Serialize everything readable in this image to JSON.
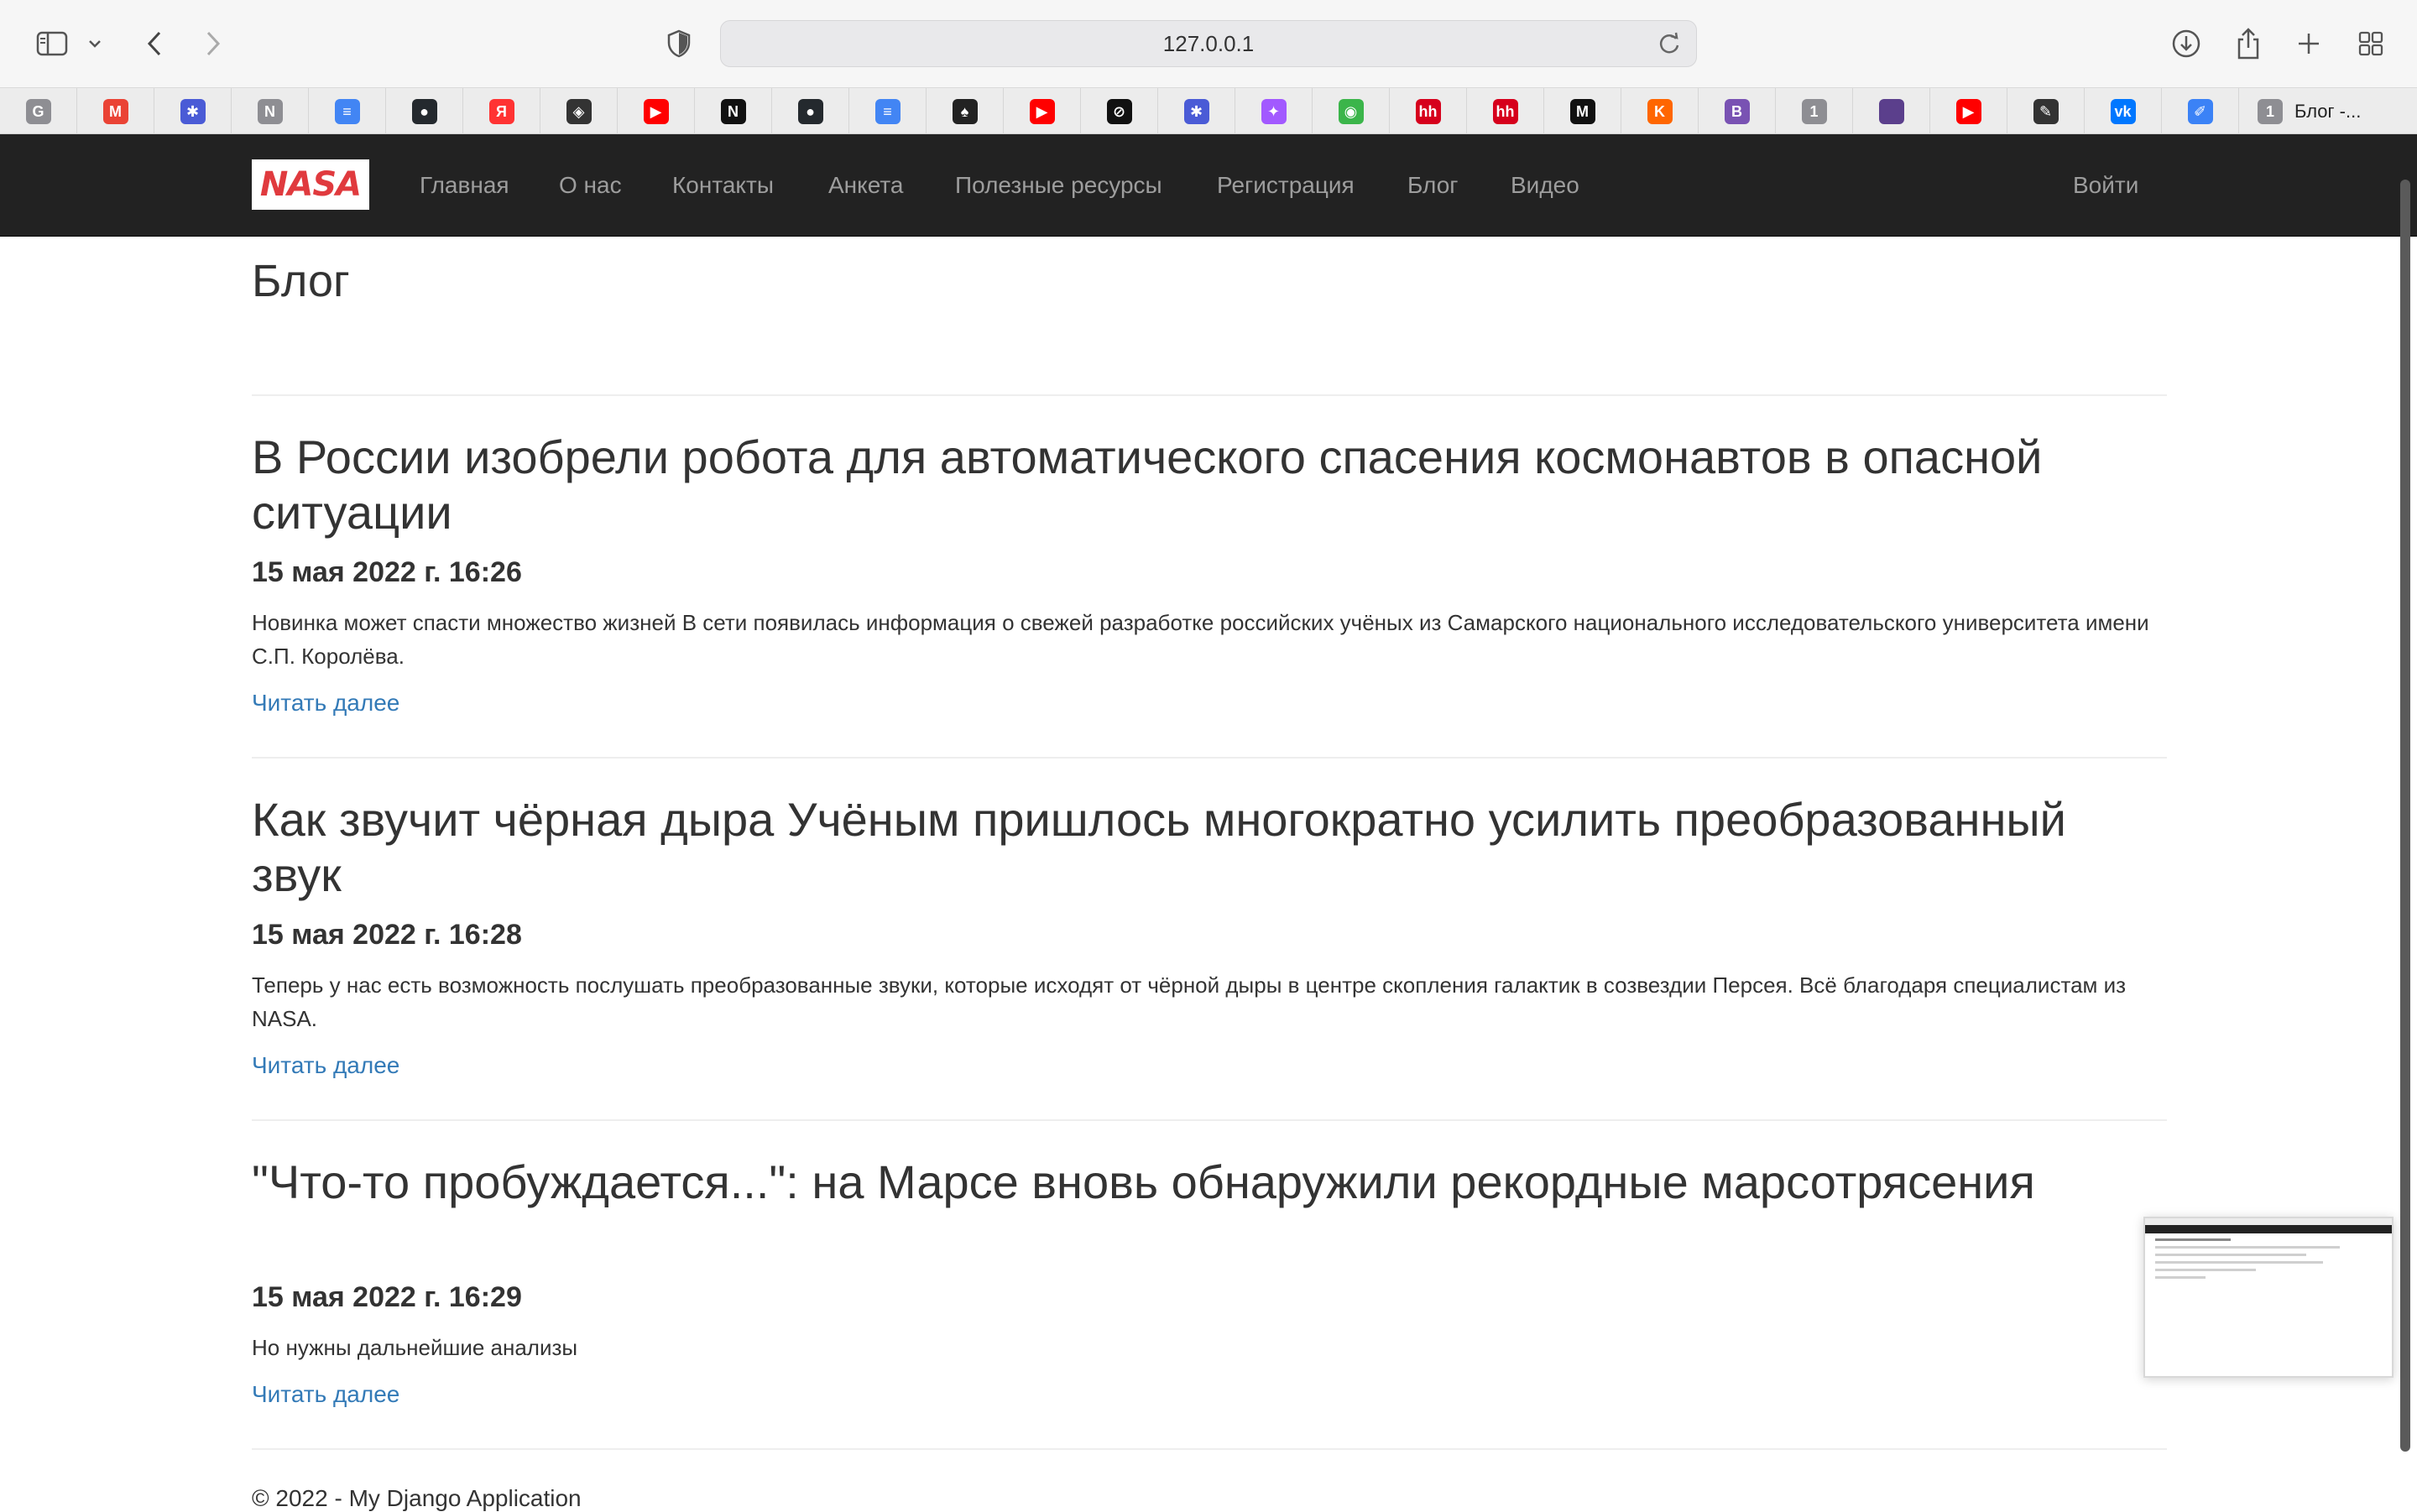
{
  "browser": {
    "url": "127.0.0.1",
    "tab_title": "Блог -...",
    "tab_count": "1",
    "favorites": [
      {
        "icon": "g-icon",
        "glyph": "G",
        "color": "#8e8e93"
      },
      {
        "icon": "gmail-icon",
        "glyph": "M",
        "color": "#ea4335"
      },
      {
        "icon": "puzzle-icon",
        "glyph": "✱",
        "color": "#4a5bd6"
      },
      {
        "icon": "n-icon",
        "glyph": "N",
        "color": "#8e8e93"
      },
      {
        "icon": "docs-icon",
        "glyph": "≡",
        "color": "#4285f4"
      },
      {
        "icon": "github-icon",
        "glyph": "●",
        "color": "#24292e"
      },
      {
        "icon": "yandex-icon",
        "glyph": "Я",
        "color": "#ff3333"
      },
      {
        "icon": "circle-logo-icon",
        "glyph": "◈",
        "color": "#333333"
      },
      {
        "icon": "youtube-icon",
        "glyph": "▶",
        "color": "#ff0000"
      },
      {
        "icon": "notion-icon",
        "glyph": "N",
        "color": "#111111"
      },
      {
        "icon": "github-icon",
        "glyph": "●",
        "color": "#24292e"
      },
      {
        "icon": "docs-icon",
        "glyph": "≡",
        "color": "#4285f4"
      },
      {
        "icon": "spade-icon",
        "glyph": "♠",
        "color": "#222222"
      },
      {
        "icon": "youtube-icon",
        "glyph": "▶",
        "color": "#ff0000"
      },
      {
        "icon": "link-icon",
        "glyph": "⊘",
        "color": "#111111"
      },
      {
        "icon": "puzzle-icon",
        "glyph": "✱",
        "color": "#4a5bd6"
      },
      {
        "icon": "figma-icon",
        "glyph": "✦",
        "color": "#a259ff"
      },
      {
        "icon": "green-circle-icon",
        "glyph": "◉",
        "color": "#3bb54a"
      },
      {
        "icon": "hh-icon",
        "glyph": "hh",
        "color": "#d6001c"
      },
      {
        "icon": "hh-icon",
        "glyph": "hh",
        "color": "#d6001c"
      },
      {
        "icon": "m-icon",
        "glyph": "M",
        "color": "#111111"
      },
      {
        "icon": "kinopoisk-icon",
        "glyph": "K",
        "color": "#ff6600"
      },
      {
        "icon": "bootstrap-icon",
        "glyph": "B",
        "color": "#7952b3"
      },
      {
        "icon": "one-icon",
        "glyph": "1",
        "color": "#8e8e93"
      },
      {
        "icon": "purple-square-icon",
        "glyph": "",
        "color": "#5b3f8c"
      },
      {
        "icon": "youtube-icon",
        "glyph": "▶",
        "color": "#ff0000"
      },
      {
        "icon": "sketch-icon",
        "glyph": "✎",
        "color": "#333333"
      },
      {
        "icon": "vk-icon",
        "glyph": "vk",
        "color": "#0077ff"
      },
      {
        "icon": "feather-icon",
        "glyph": "✐",
        "color": "#3b82f6"
      }
    ]
  },
  "navbar": {
    "logo": "NASA",
    "items": [
      "Главная",
      "О нас",
      "Контакты",
      "Анкета",
      "Полезные ресурсы",
      "Регистрация",
      "Блог",
      "Видео"
    ],
    "login": "Войти"
  },
  "page": {
    "title": "Блог",
    "read_more": "Читать далее",
    "posts": [
      {
        "title": "В России изобрели робота для автоматического спасения космонавтов в опасной ситуации",
        "date": "15 мая 2022 г. 16:26",
        "text": "Новинка может спасти множество жизней В сети появилась информация о свежей разработке российских учёных из Самарского национального исследовательского университета имени С.П. Королёва."
      },
      {
        "title": "Как звучит чёрная дыра Учёным пришлось многократно усилить преобразованный звук",
        "date": "15 мая 2022 г. 16:28",
        "text": "Теперь у нас есть возможность послушать преобразованные звуки, которые исходят от чёрной дыры в центре скопления галактик в созвездии Персея. Всё благодаря специалистам из NASA."
      },
      {
        "title": "\"Что-то пробуждается...\": на Марсе вновь обнаружили рекордные марсотрясения",
        "date": "15 мая 2022 г. 16:29",
        "text": "Но нужны дальнейшие анализы"
      }
    ],
    "footer": "© 2022 - My Django Application"
  },
  "colors": {
    "navbar_bg": "#222222",
    "nav_text": "#9d9d9d",
    "link": "#337ab7",
    "logo_red": "#e03a3e"
  }
}
